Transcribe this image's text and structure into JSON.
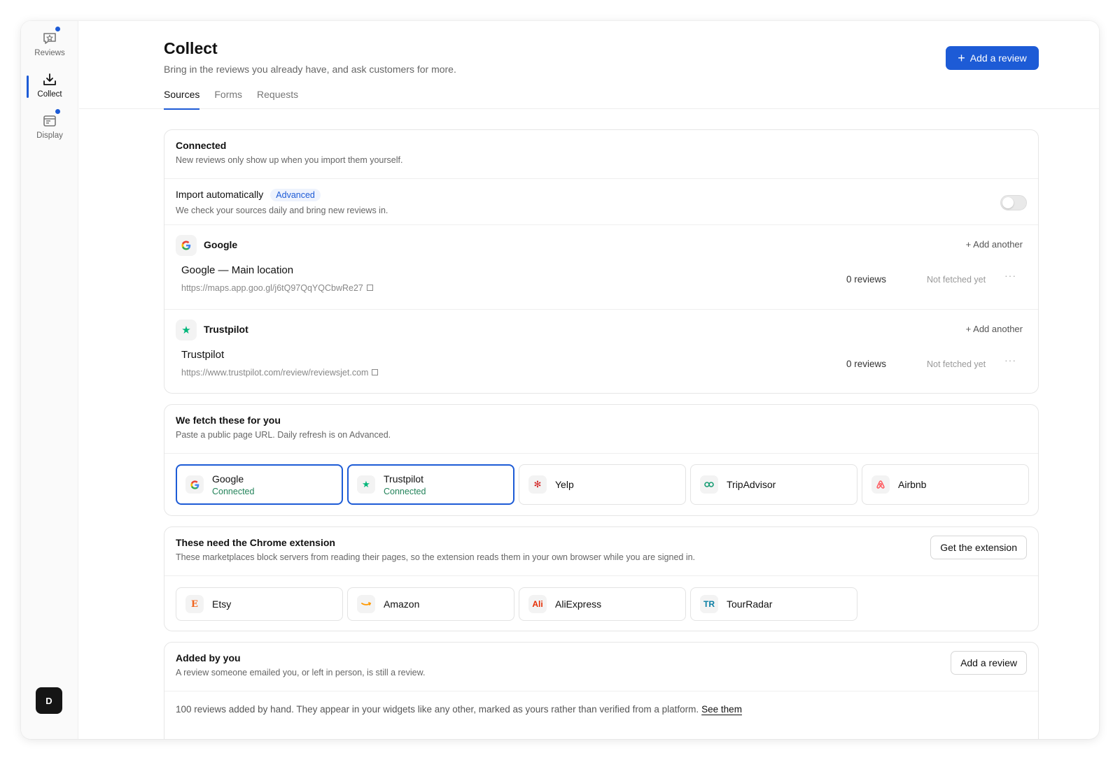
{
  "sidebar": {
    "items": [
      {
        "label": "Reviews",
        "icon": "star-chat-icon"
      },
      {
        "label": "Collect",
        "icon": "download-tray-icon"
      },
      {
        "label": "Display",
        "icon": "layout-window-icon"
      }
    ],
    "avatar": "D"
  },
  "header": {
    "title": "Collect",
    "subtitle": "Bring in the reviews you already have, and ask customers for more.",
    "tabs": [
      "Sources",
      "Forms",
      "Requests"
    ],
    "primary_button": "Add a review"
  },
  "connected": {
    "title": "Connected",
    "desc": "New reviews only show up when you import them yourself.",
    "import": {
      "label": "Import automatically",
      "badge": "Advanced",
      "desc": "We check your sources daily and bring new reviews in.",
      "enabled": false
    },
    "sources": [
      {
        "name": "Google",
        "add_another": "Add another",
        "location": "Google — Main location",
        "url": "https://maps.app.goo.gl/j6tQ97QqYQCbwRe27",
        "reviews": "0 reviews",
        "status": "Not fetched yet"
      },
      {
        "name": "Trustpilot",
        "add_another": "Add another",
        "location": "Trustpilot",
        "url": "https://www.trustpilot.com/review/reviewsjet.com",
        "reviews": "0 reviews",
        "status": "Not fetched yet"
      }
    ]
  },
  "fetch": {
    "title": "We fetch these for you",
    "desc": "Paste a public page URL. Daily refresh is on Advanced.",
    "platforms": [
      {
        "name": "Google",
        "status": "Connected"
      },
      {
        "name": "Trustpilot",
        "status": "Connected"
      },
      {
        "name": "Yelp"
      },
      {
        "name": "TripAdvisor"
      },
      {
        "name": "Airbnb"
      }
    ]
  },
  "chrome": {
    "title": "These need the Chrome extension",
    "desc": "These marketplaces block servers from reading their pages, so the extension reads them in your own browser while you are signed in.",
    "button": "Get the extension",
    "platforms": [
      {
        "name": "Etsy",
        "logo": "E"
      },
      {
        "name": "Amazon"
      },
      {
        "name": "AliExpress",
        "logo": "Ali"
      },
      {
        "name": "TourRadar",
        "logo": "TR"
      }
    ]
  },
  "manual": {
    "title": "Added by you",
    "desc": "A review someone emailed you, or left in person, is still a review.",
    "button": "Add a review",
    "info": "100 reviews added by hand. They appear in your widgets like any other, marked as yours rather than verified from a platform.",
    "link": "See them"
  },
  "colors": {
    "accent": "#1d5bd6",
    "connected_text": "#23835a",
    "google_blue": "#4285f4",
    "trustpilot_green": "#00b67a",
    "yelp_red": "#d32323",
    "tripadvisor_green": "#34e0a1",
    "airbnb_red": "#ff5a5f",
    "etsy_orange": "#f1641e",
    "amazon_orange": "#ff9900",
    "aliexpress_red": "#e62e04",
    "tourradar_blue": "#0a7ea4"
  }
}
